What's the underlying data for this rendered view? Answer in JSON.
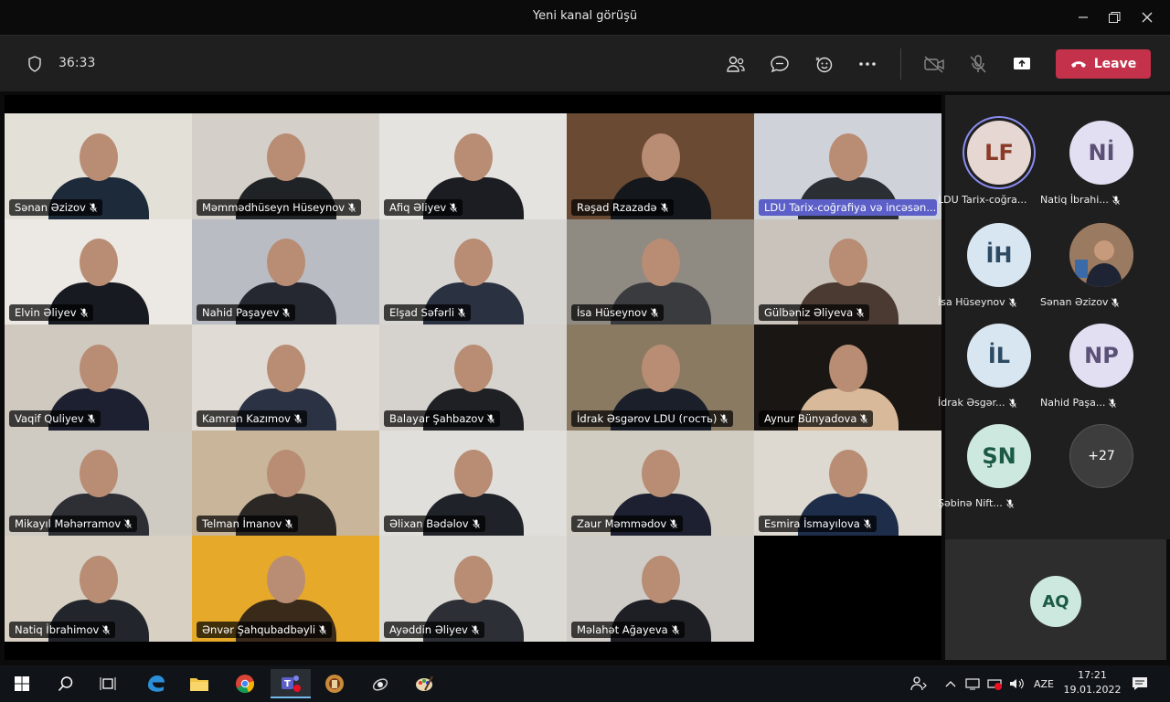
{
  "window": {
    "title": "Yeni kanal görüşü"
  },
  "controls": {
    "timer": "36:33",
    "leave_label": "Leave"
  },
  "grid_tiles": [
    {
      "name": "Sənan Əzizov",
      "bg": "#e3e0d8",
      "shirt": "#1d2a3a"
    },
    {
      "name": "Məmmədhüseyn Hüseynov",
      "bg": "#d4cfc8",
      "shirt": "#202326"
    },
    {
      "name": "Afiq Əliyev",
      "bg": "#e5e3df",
      "shirt": "#1b1d22"
    },
    {
      "name": "Rəşad Rzazadə",
      "bg": "#6a4a33",
      "shirt": "#14171c"
    },
    {
      "name": "LDU Tarix-coğrafiya və incəsən...",
      "bg": "#cfd3d9",
      "shirt": "#2b2e33",
      "highlight": true
    },
    {
      "name": "Elvin Əliyev",
      "bg": "#ece9e4",
      "shirt": "#171a20"
    },
    {
      "name": "Nahid Paşayev",
      "bg": "#b9bcc2",
      "shirt": "#252830"
    },
    {
      "name": "Elşad Səfərli",
      "bg": "#d8d6d2",
      "shirt": "#2a3140"
    },
    {
      "name": "İsa Hüseynov",
      "bg": "#8f8a82",
      "shirt": "#3a3b3f"
    },
    {
      "name": "Gülbəniz Əliyeva",
      "bg": "#c9c3bb",
      "shirt": "#4a3a32"
    },
    {
      "name": "Vaqif Quliyev",
      "bg": "#cfc9c0",
      "shirt": "#1d2030"
    },
    {
      "name": "Kamran Kazımov",
      "bg": "#e0dcd5",
      "shirt": "#2a3244"
    },
    {
      "name": "Balayar Şahbazov",
      "bg": "#d6d3ce",
      "shirt": "#1f2024"
    },
    {
      "name": "İdrak Əsgərov LDU (гость)",
      "bg": "#8a7a62",
      "shirt": "#1b1f2a"
    },
    {
      "name": "Aynur Bünyadova",
      "bg": "#1a1613",
      "shirt": "#d8b99a"
    },
    {
      "name": "Mikayıl Məhərramov",
      "bg": "#cfcac2",
      "shirt": "#2d2f35"
    },
    {
      "name": "Telman İmanov",
      "bg": "#c9b59a",
      "shirt": "#2a2724"
    },
    {
      "name": "Əlixan Bədəlov",
      "bg": "#e1dfdb",
      "shirt": "#1f2228"
    },
    {
      "name": "Zaur Məmmədov",
      "bg": "#d2cdc3",
      "shirt": "#1c2030"
    },
    {
      "name": "Esmira İsmayılova",
      "bg": "#ddd8d0",
      "shirt": "#1e2e4a"
    },
    {
      "name": "Natiq İbrahimov",
      "bg": "#d7d0c3",
      "shirt": "#22252b"
    },
    {
      "name": "Ənvər Şahqubadbəyli",
      "bg": "#e7a92a",
      "shirt": "#3a2a1a"
    },
    {
      "name": "Ayəddin Əliyev",
      "bg": "#dcdad5",
      "shirt": "#2c2f35"
    },
    {
      "name": "Məlahət Ağayeva",
      "bg": "#cfccc8",
      "shirt": "#1e1f24"
    },
    {
      "name": "Vaqif Quliyev",
      "bg": "#cfc9c0",
      "shirt": "#1d2030",
      "hidden": true
    }
  ],
  "roster": [
    {
      "initials": "LF",
      "name": "LDU Tarix-coğra...",
      "style": "ring",
      "muted": false
    },
    {
      "initials": "Nİ",
      "name": "Natiq İbrahi...",
      "style": "",
      "muted": true
    },
    {
      "initials": "İH",
      "name": "İsa Hüseynov",
      "style": "blue",
      "muted": true
    },
    {
      "initials": "",
      "name": "Sənan Əzizov",
      "style": "photo",
      "muted": true
    },
    {
      "initials": "İL",
      "name": "İdrak Əsgər...",
      "style": "blue",
      "muted": true
    },
    {
      "initials": "NP",
      "name": "Nahid Paşa...",
      "style": "",
      "muted": true
    },
    {
      "initials": "ŞN",
      "name": "Şəbinə Nift...",
      "style": "green",
      "muted": true
    },
    {
      "initials": "+27",
      "name": "",
      "style": "more",
      "muted": false
    }
  ],
  "self_view": {
    "initials": "AQ"
  },
  "taskbar": {
    "lang": "AZE",
    "time": "17:21",
    "date": "19.01.2022"
  }
}
